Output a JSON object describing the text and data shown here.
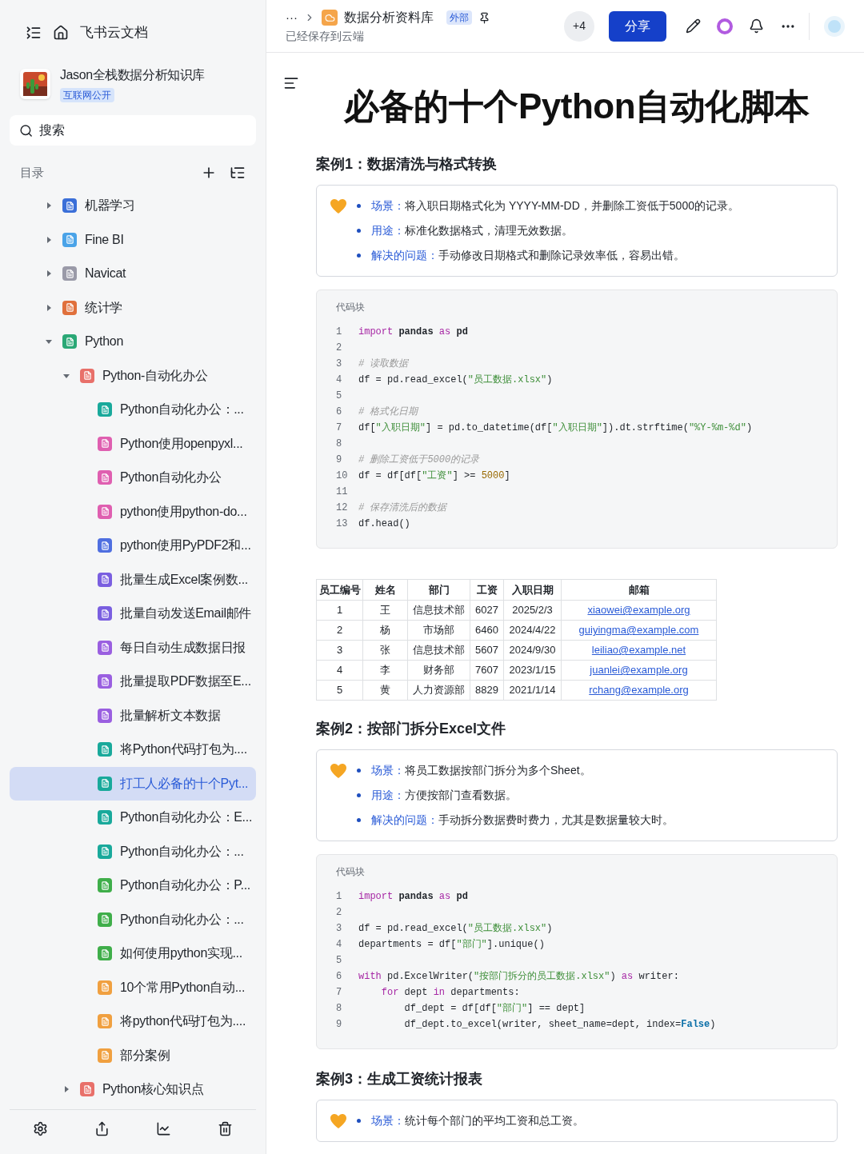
{
  "sidebar": {
    "app_title": "飞书云文档",
    "space": {
      "name": "Jason全栈数据分析知识库",
      "badge": "互联网公开"
    },
    "search": {
      "placeholder": "搜索"
    },
    "toc_label": "目录",
    "tree": [
      {
        "label": "机器学习",
        "expanded": false,
        "selected": false,
        "color": "#3b6fd8"
      },
      {
        "label": "Fine BI",
        "expanded": false,
        "selected": false,
        "color": "#4aa3e8"
      },
      {
        "label": "Navicat",
        "expanded": false,
        "selected": false,
        "color": "#9a9aa8"
      },
      {
        "label": "统计学",
        "expanded": false,
        "selected": false,
        "color": "#e0703c"
      },
      {
        "label": "Python",
        "expanded": true,
        "selected": false,
        "color": "#2aa876",
        "children": [
          {
            "label": "Python-自动化办公",
            "expanded": true,
            "selected": false,
            "color": "#e8706a",
            "children": [
              {
                "label": "Python自动化办公：...",
                "selected": false,
                "color": "#19a99b"
              },
              {
                "label": "Python使用openpyxl...",
                "selected": false,
                "color": "#df5fb0"
              },
              {
                "label": "Python自动化办公",
                "selected": false,
                "color": "#df5fb0"
              },
              {
                "label": "python使用python-do...",
                "selected": false,
                "color": "#df5fb0"
              },
              {
                "label": "python使用PyPDF2和...",
                "selected": false,
                "color": "#4f6fe0"
              },
              {
                "label": "批量生成Excel案例数...",
                "selected": false,
                "color": "#7a5fe0"
              },
              {
                "label": "批量自动发送Email邮件",
                "selected": false,
                "color": "#7a5fe0"
              },
              {
                "label": "每日自动生成数据日报",
                "selected": false,
                "color": "#9a5fe0"
              },
              {
                "label": "批量提取PDF数据至E...",
                "selected": false,
                "color": "#9a5fe0"
              },
              {
                "label": "批量解析文本数据",
                "selected": false,
                "color": "#9a5fe0"
              },
              {
                "label": "将Python代码打包为....",
                "selected": false,
                "color": "#19a99b"
              },
              {
                "label": "打工人必备的十个Pyt...",
                "selected": true,
                "color": "#19a99b"
              },
              {
                "label": "Python自动化办公：E...",
                "selected": false,
                "color": "#19a99b"
              },
              {
                "label": "Python自动化办公：...",
                "selected": false,
                "color": "#19a99b"
              },
              {
                "label": "Python自动化办公：P...",
                "selected": false,
                "color": "#3fae4a"
              },
              {
                "label": "Python自动化办公：...",
                "selected": false,
                "color": "#3fae4a"
              },
              {
                "label": "如何使用python实现...",
                "selected": false,
                "color": "#3fae4a"
              },
              {
                "label": "10个常用Python自动...",
                "selected": false,
                "color": "#f0a040"
              },
              {
                "label": "将python代码打包为....",
                "selected": false,
                "color": "#f0a040"
              },
              {
                "label": "部分案例",
                "selected": false,
                "color": "#f0a040"
              }
            ]
          },
          {
            "label": "Python核心知识点",
            "expanded": false,
            "selected": false,
            "color": "#e8706a"
          }
        ]
      }
    ]
  },
  "header": {
    "more": "···",
    "library": "数据分析资料库",
    "badge": "外部",
    "status": "已经保存到云端",
    "collaborators": "+4",
    "share": "分享"
  },
  "document": {
    "title": "必备的十个Python自动化脚本",
    "blocks": [
      {
        "kind": "heading",
        "text": "案例1：数据清洗与格式转换"
      },
      {
        "kind": "callout",
        "items": [
          {
            "label": "场景：",
            "text": "将入职日期格式化为 YYYY-MM-DD，并删除工资低于5000的记录。"
          },
          {
            "label": "用途：",
            "text": "标准化数据格式，清理无效数据。"
          },
          {
            "label": "解决的问题：",
            "text": "手动修改日期格式和删除记录效率低，容易出错。"
          }
        ]
      },
      {
        "kind": "code",
        "caption": "代码块",
        "lines": [
          {
            "number": "1",
            "tokens": [
              {
                "kind": "keyword",
                "text": "import"
              },
              {
                "kind": "bold",
                "text": " pandas "
              },
              {
                "kind": "keyword",
                "text": "as"
              },
              {
                "kind": "bold",
                "text": " pd"
              }
            ]
          },
          {
            "number": "2"
          },
          {
            "number": "3",
            "tokens": [
              {
                "kind": "comment",
                "text": "# 读取数据"
              }
            ]
          },
          {
            "number": "4",
            "tokens": [
              {
                "kind": "plain",
                "text": "df = pd.read_excel("
              },
              {
                "kind": "string",
                "text": "\"员工数据.xlsx\""
              },
              {
                "kind": "plain",
                "text": ")"
              }
            ]
          },
          {
            "number": "5"
          },
          {
            "number": "6",
            "tokens": [
              {
                "kind": "comment",
                "text": "# 格式化日期"
              }
            ]
          },
          {
            "number": "7",
            "tokens": [
              {
                "kind": "plain",
                "text": "df["
              },
              {
                "kind": "string",
                "text": "\"入职日期\""
              },
              {
                "kind": "plain",
                "text": "] = pd.to_datetime(df["
              },
              {
                "kind": "string",
                "text": "\"入职日期\""
              },
              {
                "kind": "plain",
                "text": "]).dt.strftime("
              },
              {
                "kind": "string",
                "text": "\"%Y-%m-%d\""
              },
              {
                "kind": "plain",
                "text": ")"
              }
            ]
          },
          {
            "number": "8"
          },
          {
            "number": "9",
            "tokens": [
              {
                "kind": "comment",
                "text": "# 删除工资低于5000的记录"
              }
            ]
          },
          {
            "number": "10",
            "tokens": [
              {
                "kind": "plain",
                "text": "df = df[df["
              },
              {
                "kind": "string",
                "text": "\"工资\""
              },
              {
                "kind": "plain",
                "text": "] >= "
              },
              {
                "kind": "number",
                "text": "5000"
              },
              {
                "kind": "plain",
                "text": "]"
              }
            ]
          },
          {
            "number": "11"
          },
          {
            "number": "12",
            "tokens": [
              {
                "kind": "comment",
                "text": "# 保存清洗后的数据"
              }
            ]
          },
          {
            "number": "13",
            "tokens": [
              {
                "kind": "plain",
                "text": "df.head()"
              }
            ]
          }
        ]
      },
      {
        "kind": "table",
        "columns": [
          {
            "label": "员工编号",
            "kind": "text"
          },
          {
            "label": "姓名",
            "kind": "text"
          },
          {
            "label": "部门",
            "kind": "text"
          },
          {
            "label": "工资",
            "kind": "text"
          },
          {
            "label": "入职日期",
            "kind": "text"
          },
          {
            "label": "邮箱",
            "kind": "link"
          }
        ],
        "rows": [
          [
            "1",
            "王",
            "信息技术部",
            "6027",
            "2025/2/3",
            "xiaowei@example.org"
          ],
          [
            "2",
            "杨",
            "市场部",
            "6460",
            "2024/4/22",
            "guiyingma@example.com"
          ],
          [
            "3",
            "张",
            "信息技术部",
            "5607",
            "2024/9/30",
            "leiliao@example.net"
          ],
          [
            "4",
            "李",
            "财务部",
            "7607",
            "2023/1/15",
            "juanlei@example.org"
          ],
          [
            "5",
            "黄",
            "人力资源部",
            "8829",
            "2021/1/14",
            "rchang@example.org"
          ]
        ]
      },
      {
        "kind": "heading",
        "text": "案例2：按部门拆分Excel文件"
      },
      {
        "kind": "callout",
        "items": [
          {
            "label": "场景：",
            "text": "将员工数据按部门拆分为多个Sheet。"
          },
          {
            "label": "用途：",
            "text": "方便按部门查看数据。"
          },
          {
            "label": "解决的问题：",
            "text": "手动拆分数据费时费力，尤其是数据量较大时。"
          }
        ]
      },
      {
        "kind": "code",
        "caption": "代码块",
        "lines": [
          {
            "number": "1",
            "tokens": [
              {
                "kind": "keyword",
                "text": "import"
              },
              {
                "kind": "bold",
                "text": " pandas "
              },
              {
                "kind": "keyword",
                "text": "as"
              },
              {
                "kind": "bold",
                "text": " pd"
              }
            ]
          },
          {
            "number": "2"
          },
          {
            "number": "3",
            "tokens": [
              {
                "kind": "plain",
                "text": "df = pd.read_excel("
              },
              {
                "kind": "string",
                "text": "\"员工数据.xlsx\""
              },
              {
                "kind": "plain",
                "text": ")"
              }
            ]
          },
          {
            "number": "4",
            "tokens": [
              {
                "kind": "plain",
                "text": "departments = df["
              },
              {
                "kind": "string",
                "text": "\"部门\""
              },
              {
                "kind": "plain",
                "text": "].unique()"
              }
            ]
          },
          {
            "number": "5"
          },
          {
            "number": "6",
            "tokens": [
              {
                "kind": "keyword",
                "text": "with"
              },
              {
                "kind": "plain",
                "text": " pd.ExcelWriter("
              },
              {
                "kind": "string",
                "text": "\"按部门拆分的员工数据.xlsx\""
              },
              {
                "kind": "plain",
                "text": ") "
              },
              {
                "kind": "keyword",
                "text": "as"
              },
              {
                "kind": "plain",
                "text": " writer:"
              }
            ]
          },
          {
            "number": "7",
            "tokens": [
              {
                "kind": "keyword",
                "text": "    for"
              },
              {
                "kind": "plain",
                "text": " dept "
              },
              {
                "kind": "keyword",
                "text": "in"
              },
              {
                "kind": "plain",
                "text": " departments:"
              }
            ]
          },
          {
            "number": "8",
            "tokens": [
              {
                "kind": "plain",
                "text": "        df_dept = df[df["
              },
              {
                "kind": "string",
                "text": "\"部门\""
              },
              {
                "kind": "plain",
                "text": "] == dept]"
              }
            ]
          },
          {
            "number": "9",
            "tokens": [
              {
                "kind": "plain",
                "text": "        df_dept.to_excel(writer, sheet_name=dept, index="
              },
              {
                "kind": "constant",
                "text": "False"
              },
              {
                "kind": "plain",
                "text": ")"
              }
            ]
          }
        ]
      },
      {
        "kind": "heading",
        "text": "案例3：生成工资统计报表"
      },
      {
        "kind": "callout",
        "items": [
          {
            "label": "场景：",
            "text": "统计每个部门的平均工资和总工资。"
          }
        ]
      }
    ]
  }
}
